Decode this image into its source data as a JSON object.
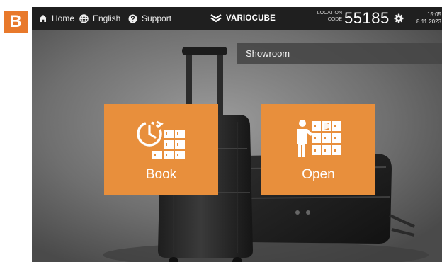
{
  "panel": {
    "label": "B"
  },
  "nav": {
    "home_label": "Home",
    "language_label": "English",
    "support_label": "Support"
  },
  "brand": {
    "name": "VARIOCUBE"
  },
  "location": {
    "caption_line1": "LOCATION",
    "caption_line2": "CODE",
    "code": "55185"
  },
  "clock": {
    "time": "15:05",
    "date": "8.11.2023"
  },
  "site": {
    "name": "Showroom"
  },
  "actions": {
    "book_label": "Book",
    "open_label": "Open"
  },
  "icons": [
    "home-icon",
    "globe-icon",
    "help-icon",
    "variocube-logo-icon",
    "gear-icon",
    "clock-lockers-icon",
    "person-lockers-icon"
  ],
  "colors": {
    "accent": "#e88f3c",
    "panel_label": "#e8792b",
    "topbar": "#1f1f1f"
  }
}
